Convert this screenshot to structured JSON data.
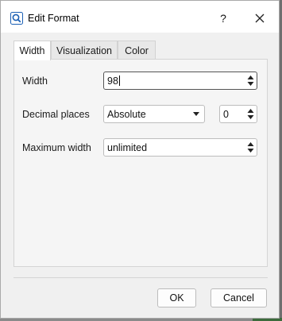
{
  "window": {
    "title": "Edit Format",
    "help_label": "?"
  },
  "tabs": [
    {
      "label": "Width"
    },
    {
      "label": "Visualization"
    },
    {
      "label": "Color"
    }
  ],
  "form": {
    "width": {
      "label": "Width",
      "value": "98"
    },
    "decimal_places": {
      "label": "Decimal places",
      "mode_value": "Absolute",
      "count_value": "0"
    },
    "maximum_width": {
      "label": "Maximum width",
      "value": "unlimited"
    }
  },
  "buttons": {
    "ok": "OK",
    "cancel": "Cancel"
  },
  "colors": {
    "app_icon": "#1a5fb4",
    "focus_border": "#555555"
  }
}
